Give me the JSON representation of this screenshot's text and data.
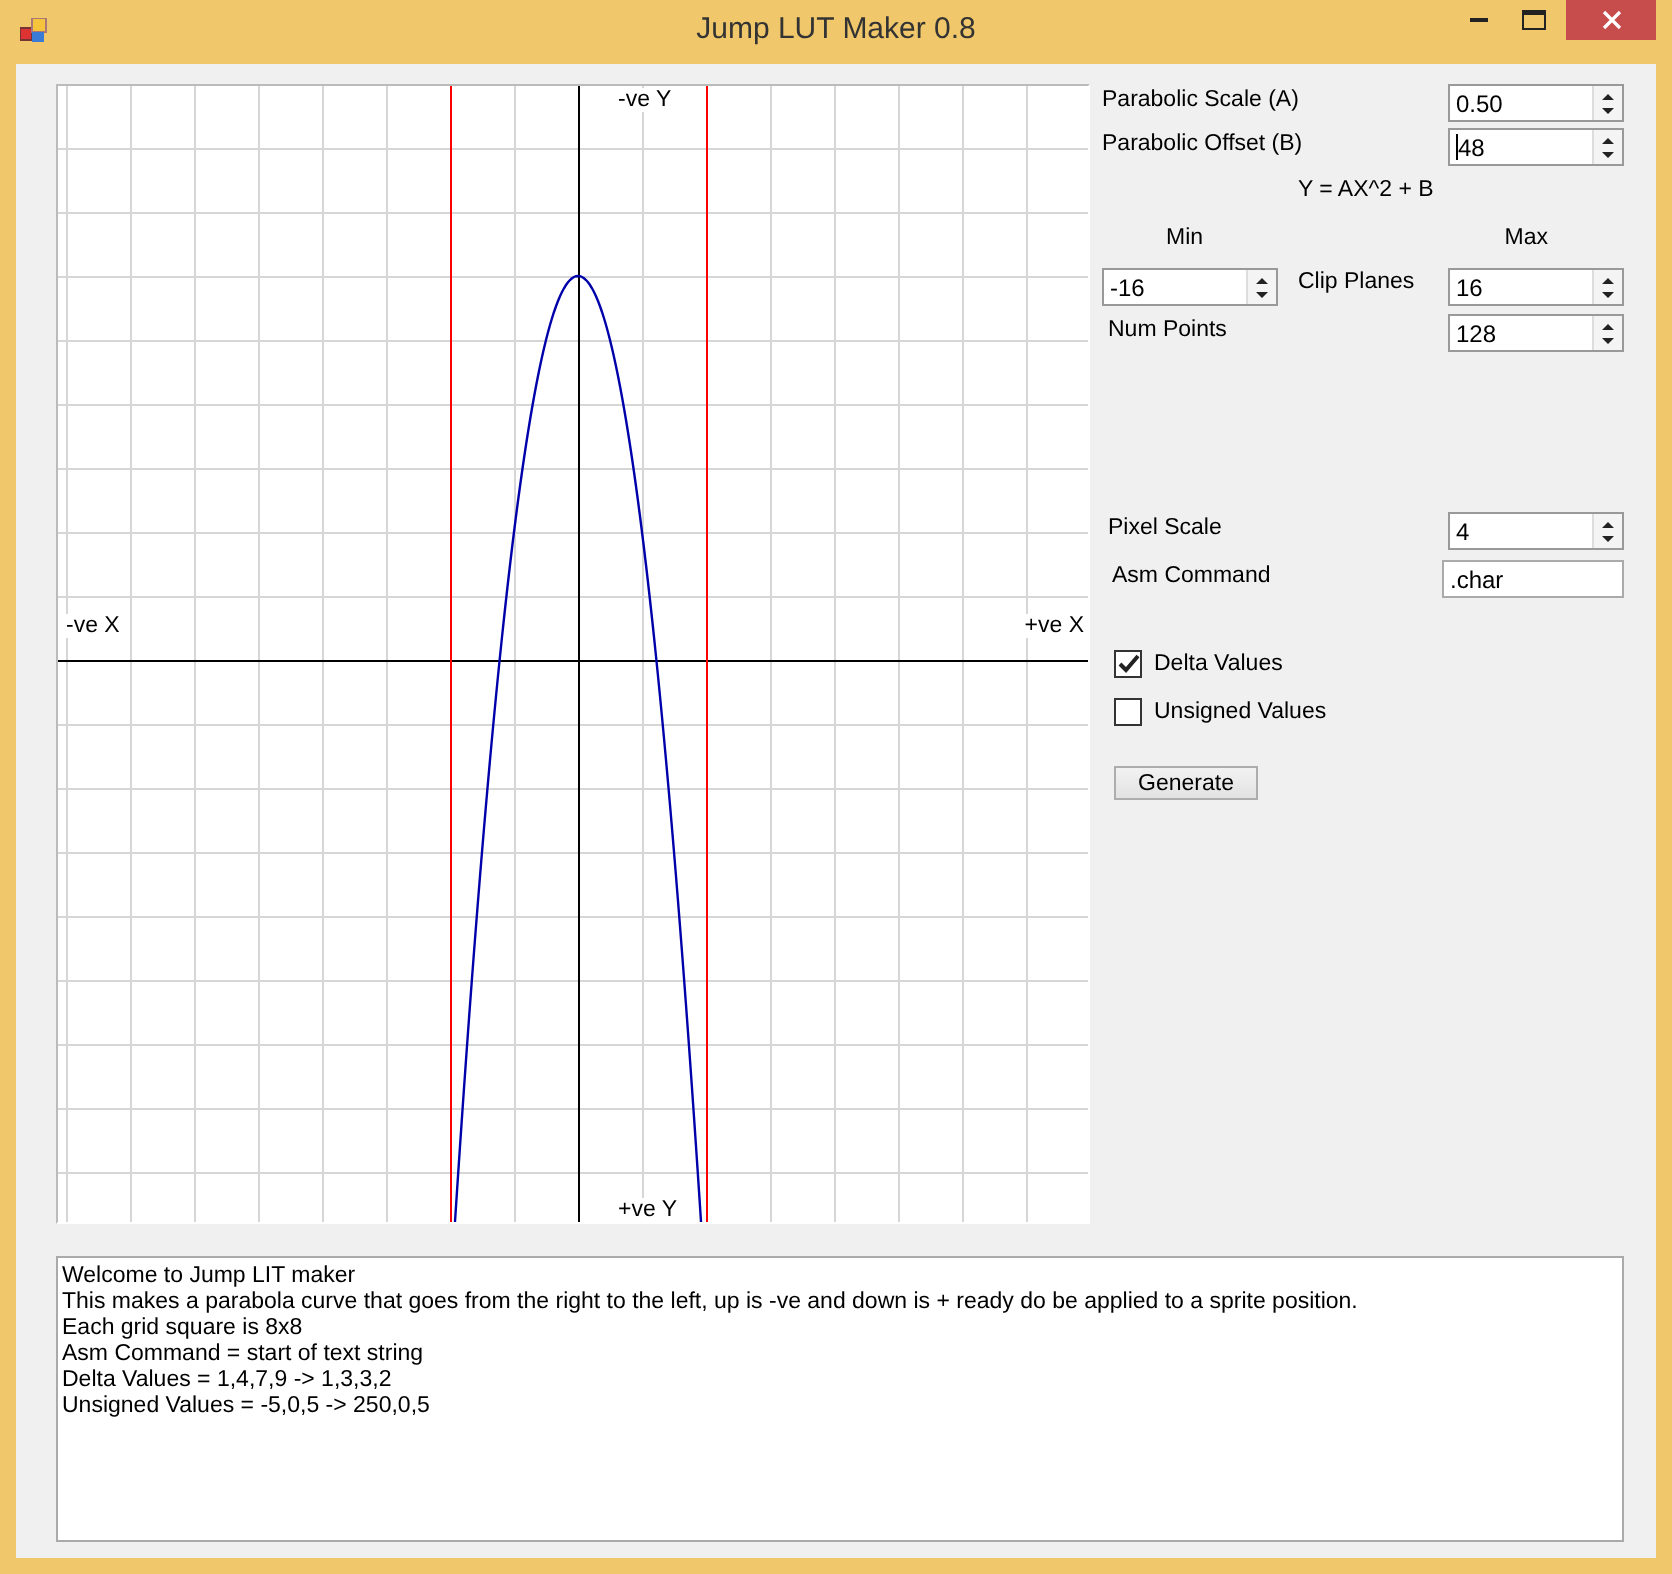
{
  "window": {
    "title": "Jump LUT Maker 0.8"
  },
  "plot": {
    "top_label": "-ve Y",
    "bottom_label": "+ve Y",
    "left_label": "-ve X",
    "right_label": "+ve X"
  },
  "scale": {
    "label": "Parabolic Scale (A)",
    "value": "0.50",
    "focused": false
  },
  "offset": {
    "label": "Parabolic Offset (B)",
    "value": "48",
    "focused": true
  },
  "formula": "Y  = AX^2 + B",
  "min_label": "Min",
  "max_label": "Max",
  "clip": {
    "label": "Clip Planes",
    "min": "-16",
    "max": "16"
  },
  "num_points": {
    "label": "Num Points",
    "value": "128"
  },
  "pixel_scale": {
    "label": "Pixel Scale",
    "value": "4"
  },
  "asm_command": {
    "label": "Asm Command",
    "value": ".char"
  },
  "checkboxes": [
    {
      "label": "Delta Values",
      "checked": true
    },
    {
      "label": "Unsigned Values",
      "checked": false
    }
  ],
  "generate_button": "Generate",
  "log": [
    "Welcome to Jump LIT maker",
    "This makes a parabola curve that goes from the right to the left, up is -ve and down is + ready do be applied to a sprite position.",
    "Each grid square is 8x8",
    "Asm Command = start of text string",
    "Delta Values = 1,4,7,9 -> 1,3,3,2",
    "Unsigned Values = -5,0,5 -> 250,0,5"
  ]
}
